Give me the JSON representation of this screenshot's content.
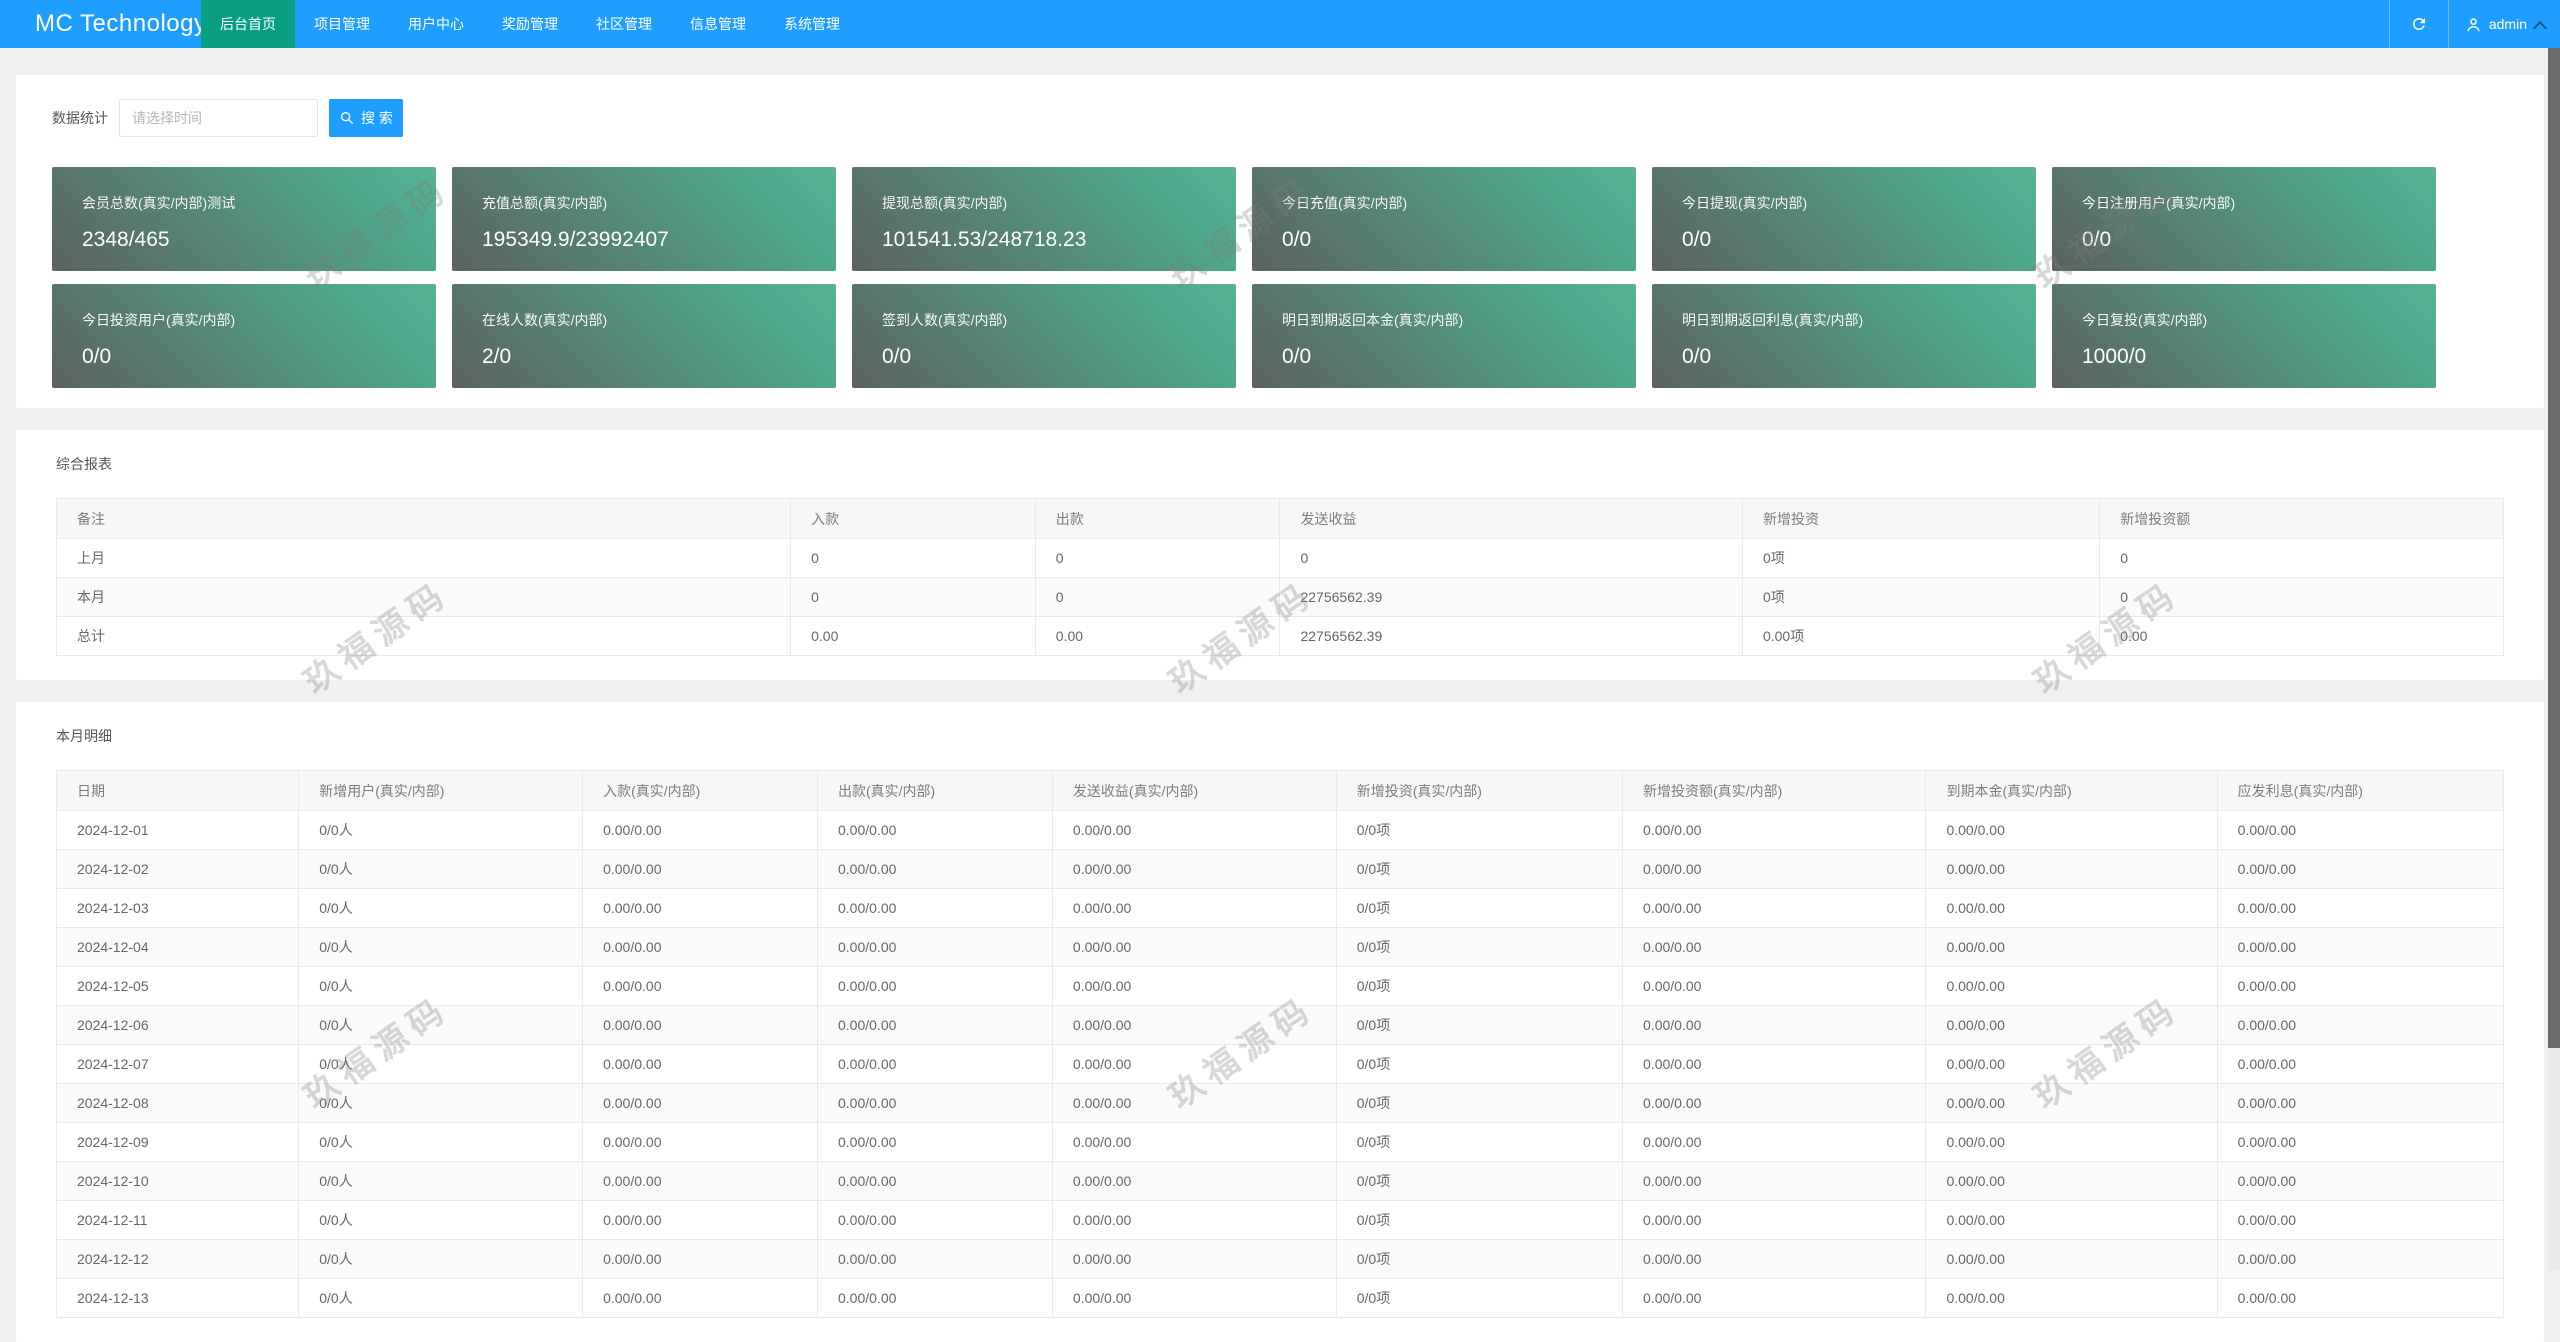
{
  "navbar": {
    "brand": "MC Technology",
    "items": [
      {
        "label": "后台首页",
        "active": true
      },
      {
        "label": "项目管理",
        "active": false
      },
      {
        "label": "用户中心",
        "active": false
      },
      {
        "label": "奖励管理",
        "active": false
      },
      {
        "label": "社区管理",
        "active": false
      },
      {
        "label": "信息管理",
        "active": false
      },
      {
        "label": "系统管理",
        "active": false
      }
    ],
    "user": "admin",
    "icons": {
      "refresh": "refresh-icon",
      "user": "person-icon",
      "chevron": "chevron-up-icon"
    }
  },
  "search": {
    "label": "数据统计",
    "placeholder": "请选择时间",
    "button": "搜 索"
  },
  "stat_cards": [
    {
      "title": "会员总数(真实/内部)测试",
      "value": "2348/465"
    },
    {
      "title": "充值总额(真实/内部)",
      "value": "195349.9/23992407"
    },
    {
      "title": "提现总额(真实/内部)",
      "value": "101541.53/248718.23"
    },
    {
      "title": "今日充值(真实/内部)",
      "value": "0/0"
    },
    {
      "title": "今日提现(真实/内部)",
      "value": "0/0"
    },
    {
      "title": "今日注册用户(真实/内部)",
      "value": "0/0"
    },
    {
      "title": "今日投资用户(真实/内部)",
      "value": "0/0"
    },
    {
      "title": "在线人数(真实/内部)",
      "value": "2/0"
    },
    {
      "title": "签到人数(真实/内部)",
      "value": "0/0"
    },
    {
      "title": "明日到期返回本金(真实/内部)",
      "value": "0/0"
    },
    {
      "title": "明日到期返回利息(真实/内部)",
      "value": "0/0"
    },
    {
      "title": "今日复投(真实/内部)",
      "value": "1000/0"
    }
  ],
  "report": {
    "title": "综合报表",
    "headers": [
      "备注",
      "入款",
      "出款",
      "发送收益",
      "新增投资",
      "新增投资额"
    ],
    "rows": [
      [
        "上月",
        "0",
        "0",
        "0",
        "0项",
        "0"
      ],
      [
        "本月",
        "0",
        "0",
        "22756562.39",
        "0项",
        "0"
      ],
      [
        "总计",
        "0.00",
        "0.00",
        "22756562.39",
        "0.00项",
        "0.00"
      ]
    ]
  },
  "detail": {
    "title": "本月明细",
    "headers": [
      "日期",
      "新增用户(真实/内部)",
      "入款(真实/内部)",
      "出款(真实/内部)",
      "发送收益(真实/内部)",
      "新增投资(真实/内部)",
      "新增投资额(真实/内部)",
      "到期本金(真实/内部)",
      "应发利息(真实/内部)"
    ],
    "rows": [
      [
        "2024-12-01",
        "0/0人",
        "0.00/0.00",
        "0.00/0.00",
        "0.00/0.00",
        "0/0项",
        "0.00/0.00",
        "0.00/0.00",
        "0.00/0.00"
      ],
      [
        "2024-12-02",
        "0/0人",
        "0.00/0.00",
        "0.00/0.00",
        "0.00/0.00",
        "0/0项",
        "0.00/0.00",
        "0.00/0.00",
        "0.00/0.00"
      ],
      [
        "2024-12-03",
        "0/0人",
        "0.00/0.00",
        "0.00/0.00",
        "0.00/0.00",
        "0/0项",
        "0.00/0.00",
        "0.00/0.00",
        "0.00/0.00"
      ],
      [
        "2024-12-04",
        "0/0人",
        "0.00/0.00",
        "0.00/0.00",
        "0.00/0.00",
        "0/0项",
        "0.00/0.00",
        "0.00/0.00",
        "0.00/0.00"
      ],
      [
        "2024-12-05",
        "0/0人",
        "0.00/0.00",
        "0.00/0.00",
        "0.00/0.00",
        "0/0项",
        "0.00/0.00",
        "0.00/0.00",
        "0.00/0.00"
      ],
      [
        "2024-12-06",
        "0/0人",
        "0.00/0.00",
        "0.00/0.00",
        "0.00/0.00",
        "0/0项",
        "0.00/0.00",
        "0.00/0.00",
        "0.00/0.00"
      ],
      [
        "2024-12-07",
        "0/0人",
        "0.00/0.00",
        "0.00/0.00",
        "0.00/0.00",
        "0/0项",
        "0.00/0.00",
        "0.00/0.00",
        "0.00/0.00"
      ],
      [
        "2024-12-08",
        "0/0人",
        "0.00/0.00",
        "0.00/0.00",
        "0.00/0.00",
        "0/0项",
        "0.00/0.00",
        "0.00/0.00",
        "0.00/0.00"
      ],
      [
        "2024-12-09",
        "0/0人",
        "0.00/0.00",
        "0.00/0.00",
        "0.00/0.00",
        "0/0项",
        "0.00/0.00",
        "0.00/0.00",
        "0.00/0.00"
      ],
      [
        "2024-12-10",
        "0/0人",
        "0.00/0.00",
        "0.00/0.00",
        "0.00/0.00",
        "0/0项",
        "0.00/0.00",
        "0.00/0.00",
        "0.00/0.00"
      ],
      [
        "2024-12-11",
        "0/0人",
        "0.00/0.00",
        "0.00/0.00",
        "0.00/0.00",
        "0/0项",
        "0.00/0.00",
        "0.00/0.00",
        "0.00/0.00"
      ],
      [
        "2024-12-12",
        "0/0人",
        "0.00/0.00",
        "0.00/0.00",
        "0.00/0.00",
        "0/0项",
        "0.00/0.00",
        "0.00/0.00",
        "0.00/0.00"
      ],
      [
        "2024-12-13",
        "0/0人",
        "0.00/0.00",
        "0.00/0.00",
        "0.00/0.00",
        "0/0项",
        "0.00/0.00",
        "0.00/0.00",
        "0.00/0.00"
      ]
    ]
  },
  "watermark": {
    "text": "玖福源码"
  },
  "colors": {
    "navbar": "#1E9FFF",
    "nav_active": "#089E82",
    "accent_button": "#1E9FFF",
    "card_gradient_dark": "#5b615f",
    "card_gradient_green": "#57b296",
    "page_bg": "#eff0f0"
  }
}
